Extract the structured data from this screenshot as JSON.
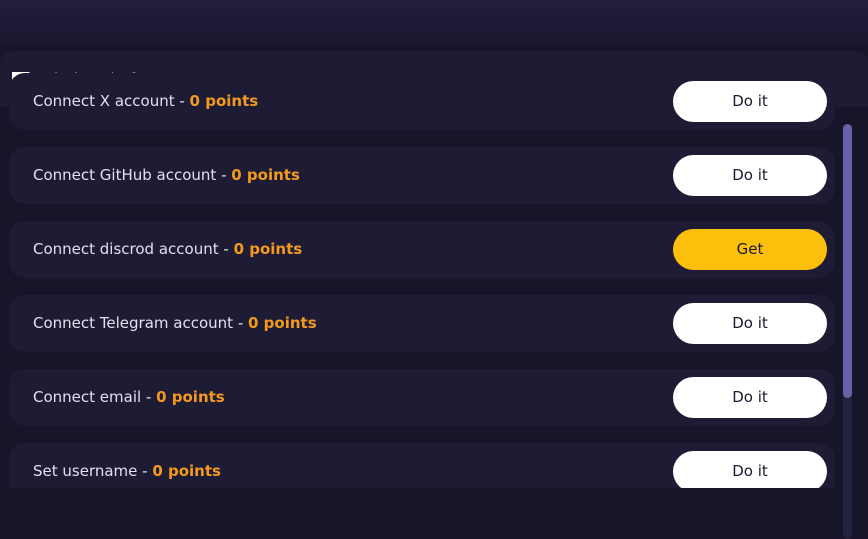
{
  "header": {
    "title": "Mission Platform",
    "icon": "flag-icon"
  },
  "tasks": [
    {
      "label": "Connect X account - ",
      "points": "0 points",
      "action": "Do it",
      "action_style": "white"
    },
    {
      "label": "Connect GitHub account - ",
      "points": "0 points",
      "action": "Do it",
      "action_style": "white"
    },
    {
      "label": "Connect discrod account - ",
      "points": "0 points",
      "action": "Get",
      "action_style": "yellow"
    },
    {
      "label": "Connect Telegram account - ",
      "points": "0 points",
      "action": "Do it",
      "action_style": "white"
    },
    {
      "label": "Connect email - ",
      "points": "0 points",
      "action": "Do it",
      "action_style": "white"
    },
    {
      "label": "Set username - ",
      "points": "0 points",
      "action": "Do it",
      "action_style": "white"
    }
  ],
  "colors": {
    "background": "#17152a",
    "row": "#1e1c35",
    "points": "#f39a1e",
    "get_button": "#fbbf0c",
    "scroll_thumb": "#6a62a8"
  }
}
